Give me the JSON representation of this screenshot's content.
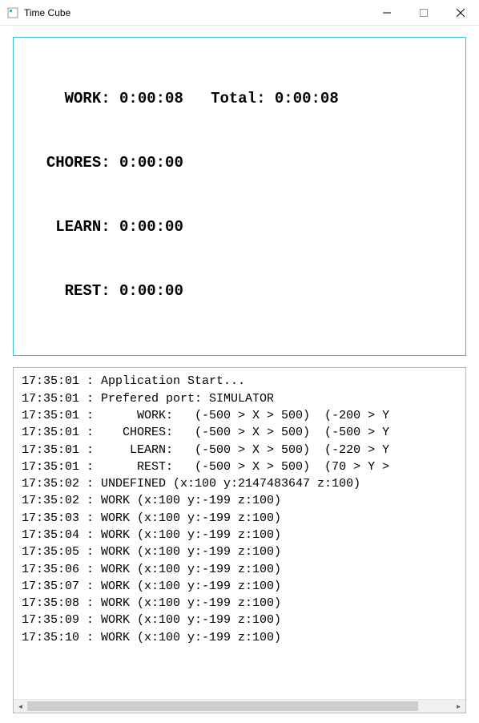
{
  "window": {
    "title": "Time Cube"
  },
  "timers": {
    "work_label": "WORK:",
    "work_value": "0:00:08",
    "total_label": "Total:",
    "total_value": "0:00:08",
    "chores_label": "CHORES:",
    "chores_value": "0:00:00",
    "learn_label": "LEARN:",
    "learn_value": "0:00:00",
    "rest_label": "REST:",
    "rest_value": "0:00:00"
  },
  "log": {
    "lines": [
      "17:35:01 : Application Start...",
      "17:35:01 : Prefered port: SIMULATOR",
      "17:35:01 :      WORK:   (-500 > X > 500)  (-200 > Y",
      "17:35:01 :    CHORES:   (-500 > X > 500)  (-500 > Y",
      "17:35:01 :     LEARN:   (-500 > X > 500)  (-220 > Y",
      "17:35:01 :      REST:   (-500 > X > 500)  (70 > Y >",
      "17:35:02 : UNDEFINED (x:100 y:2147483647 z:100)",
      "17:35:02 : WORK (x:100 y:-199 z:100)",
      "17:35:03 : WORK (x:100 y:-199 z:100)",
      "17:35:04 : WORK (x:100 y:-199 z:100)",
      "17:35:05 : WORK (x:100 y:-199 z:100)",
      "17:35:06 : WORK (x:100 y:-199 z:100)",
      "17:35:07 : WORK (x:100 y:-199 z:100)",
      "17:35:08 : WORK (x:100 y:-199 z:100)",
      "17:35:09 : WORK (x:100 y:-199 z:100)",
      "17:35:10 : WORK (x:100 y:-199 z:100)"
    ]
  },
  "colors": {
    "panel_border": "#36c5cc"
  }
}
